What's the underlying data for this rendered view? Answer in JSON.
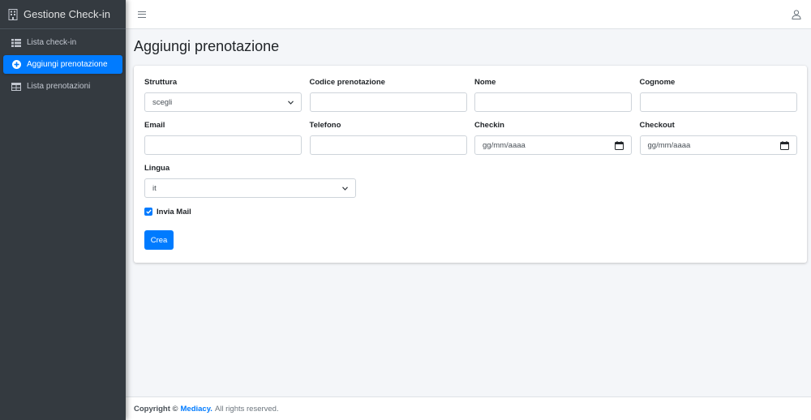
{
  "app": {
    "brand": "Gestione Check-in"
  },
  "sidebar": {
    "items": [
      {
        "label": "Lista check-in",
        "icon": "list-icon",
        "active": false
      },
      {
        "label": "Aggiungi prenotazione",
        "icon": "plus-circle-icon",
        "active": true
      },
      {
        "label": "Lista prenotazioni",
        "icon": "table-icon",
        "active": false
      }
    ]
  },
  "page": {
    "title": "Aggiungi prenotazione"
  },
  "form": {
    "struttura": {
      "label": "Struttura",
      "value": "scegli"
    },
    "codice": {
      "label": "Codice prenotazione",
      "value": ""
    },
    "nome": {
      "label": "Nome",
      "value": ""
    },
    "cognome": {
      "label": "Cognome",
      "value": ""
    },
    "email": {
      "label": "Email",
      "value": ""
    },
    "telefono": {
      "label": "Telefono",
      "value": ""
    },
    "checkin": {
      "label": "Checkin",
      "placeholder": "gg/mm/aaaa"
    },
    "checkout": {
      "label": "Checkout",
      "placeholder": "gg/mm/aaaa"
    },
    "lingua": {
      "label": "Lingua",
      "value": "it"
    },
    "invia_mail": {
      "label": "Invia Mail",
      "checked": true
    },
    "submit": "Crea"
  },
  "footer": {
    "prefix": "Copyright ©",
    "brand": "Mediacy.",
    "suffix": "All rights reserved."
  },
  "colors": {
    "accent": "#007bff",
    "sidebar_bg": "#343a40",
    "page_bg": "#f4f6f9"
  }
}
